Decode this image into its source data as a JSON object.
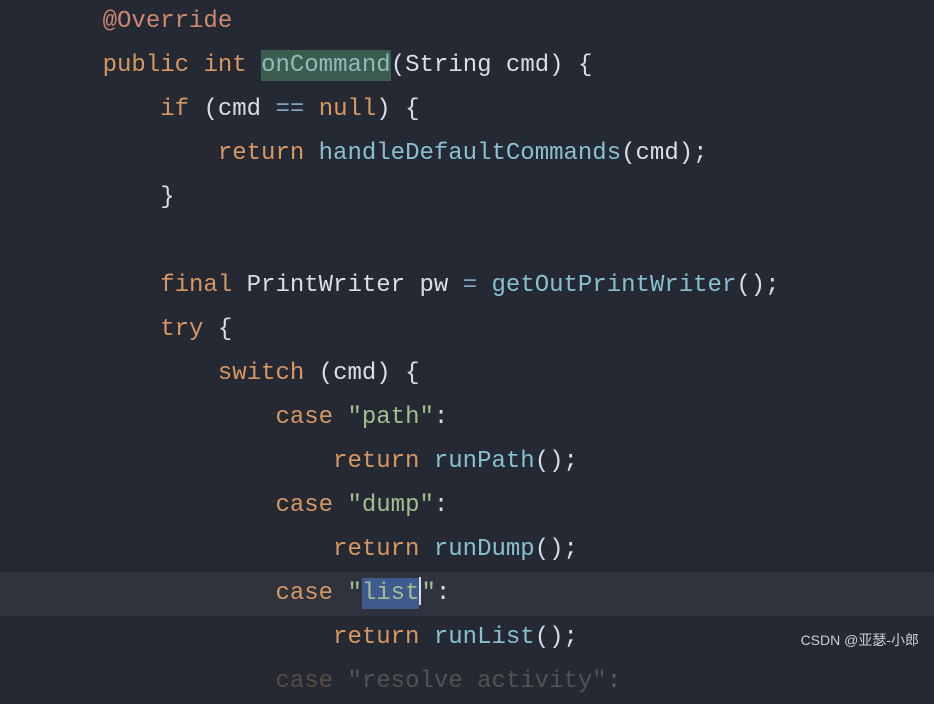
{
  "code": {
    "annotation": "@Override",
    "visibility": "public",
    "returnType": "int",
    "methodName": "onCommand",
    "paramType": "String",
    "paramName": "cmd",
    "ifKeyword": "if",
    "cmdVar": "cmd",
    "eqOp": "==",
    "nullKeyword": "null",
    "returnKeyword": "return",
    "handleDefault": "handleDefaultCommands",
    "finalKeyword": "final",
    "pwType": "PrintWriter",
    "pwVar": "pw",
    "assignOp": "=",
    "getOutPw": "getOutPrintWriter",
    "tryKeyword": "try",
    "switchKeyword": "switch",
    "caseKeyword": "case",
    "pathStr": "\"path\"",
    "runPath": "runPath",
    "dumpStr": "\"dump\"",
    "runDump": "runDump",
    "listQuoteOpen": "\"",
    "listStr": "list",
    "listQuoteClose": "\"",
    "runList": "runList",
    "resolveCutoff": "\"resolve activity\"",
    "openParen": "(",
    "closeParen": ")",
    "openBrace": "{",
    "closeBrace": "}",
    "colon": ":",
    "semicolon": ";",
    "emptyParens": "()"
  },
  "watermark": "CSDN @亚瑟-小郎"
}
